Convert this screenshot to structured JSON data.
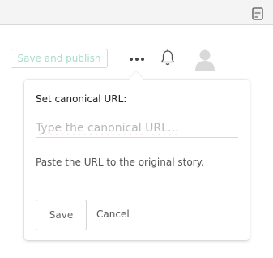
{
  "browser": {
    "reader_icon": "reader-mode-icon"
  },
  "toolbar": {
    "publish_label": "Save and publish",
    "more_icon": "more-options-icon",
    "bell_icon": "notifications-icon",
    "avatar_icon": "user-avatar-icon"
  },
  "popover": {
    "title": "Set canonical URL:",
    "input": {
      "value": "",
      "placeholder": "Type the canonical URL…"
    },
    "helper_text": "Paste the URL to the original story.",
    "save_label": "Save",
    "cancel_label": "Cancel"
  },
  "colors": {
    "publish_border": "#bfe5d5",
    "publish_text": "#a9dcc8",
    "placeholder_text": "#b8b8b8",
    "spellcheck_underline": "#e05555"
  }
}
